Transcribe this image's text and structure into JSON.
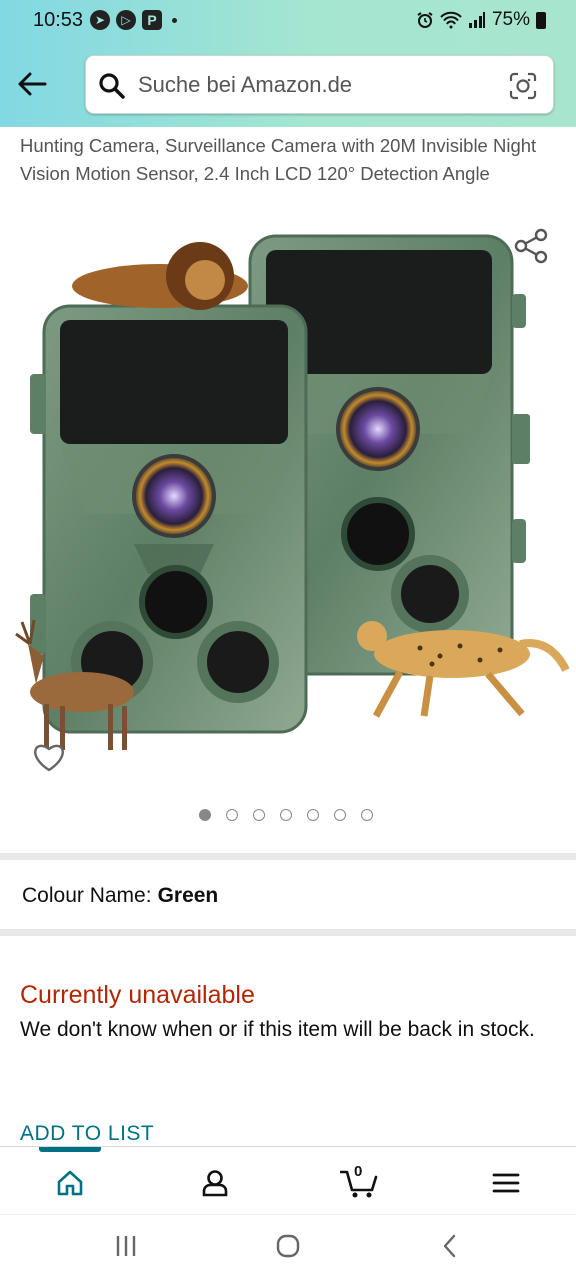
{
  "status_bar": {
    "time": "10:53",
    "battery": "75%",
    "icons": [
      "telegram-icon",
      "play-icon",
      "p-app-icon",
      "alarm-icon",
      "wifi-icon",
      "signal-icon",
      "battery-icon"
    ]
  },
  "header": {
    "back_icon": "back-arrow-icon",
    "search_placeholder": "Suche bei Amazon.de",
    "search_icon": "search-icon",
    "camera_search_icon": "camera-lens-icon"
  },
  "product": {
    "title": "Hunting Camera, Surveillance Camera with 20M Invisible Night Vision Motion Sensor, 2.4 Inch LCD 120° Detection Angle",
    "image_count": 7,
    "active_image": 0,
    "colour_label": "Colour Name:",
    "colour_value": "Green",
    "availability": "Currently unavailable",
    "availability_desc": "We don't know when or if this item will be back in stock.",
    "add_to_list": "ADD TO LIST"
  },
  "bottom_nav": {
    "items": [
      "home-icon",
      "account-icon",
      "cart-icon",
      "menu-icon"
    ],
    "cart_count": "0",
    "active": 0
  },
  "colors": {
    "accent": "#007185",
    "unavailable": "#b12704",
    "header_gradient_start": "#82d8e3",
    "header_gradient_end": "#a8e5cf"
  }
}
